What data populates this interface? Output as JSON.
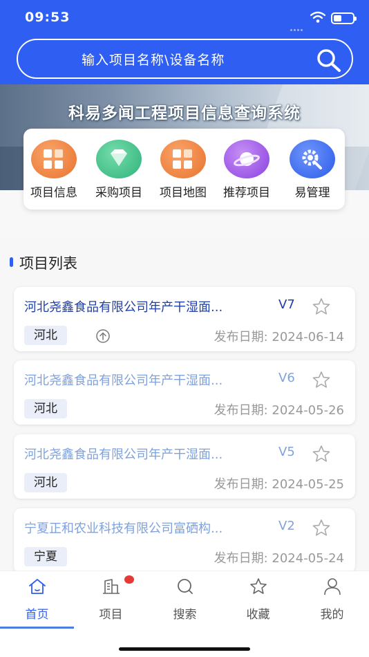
{
  "status_bar": {
    "time": "09:53"
  },
  "search": {
    "placeholder": "输入项目名称\\设备名称"
  },
  "banner": {
    "title": "科易多闻工程项目信息查询系统"
  },
  "quick_menu": [
    {
      "label": "项目信息",
      "icon": "grid-icon",
      "color": "#f0803c"
    },
    {
      "label": "采购项目",
      "icon": "diamond-icon",
      "color": "#3fc18a"
    },
    {
      "label": "项目地图",
      "icon": "grid-icon",
      "color": "#f0803c"
    },
    {
      "label": "推荐项目",
      "icon": "planet-icon",
      "color": "#a35ce8"
    },
    {
      "label": "易管理",
      "icon": "gear-wrench-icon",
      "color": "#3b6ff5"
    }
  ],
  "project_list": {
    "title": "项目列表",
    "items": [
      {
        "name": "河北尧鑫食品有限公司年产干湿面...",
        "version": "V7",
        "region": "河北",
        "date": "发布日期: 2024-06-14",
        "unread": true
      },
      {
        "name": "河北尧鑫食品有限公司年产干湿面...",
        "version": "V6",
        "region": "河北",
        "date": "发布日期: 2024-05-26",
        "unread": false
      },
      {
        "name": "河北尧鑫食品有限公司年产干湿面...",
        "version": "V5",
        "region": "河北",
        "date": "发布日期: 2024-05-25",
        "unread": false
      },
      {
        "name": "宁夏正和农业科技有限公司富硒构...",
        "version": "V2",
        "region": "宁夏",
        "date": "发布日期: 2024-05-24",
        "unread": false
      }
    ]
  },
  "tabbar": [
    {
      "label": "首页",
      "icon": "home-icon",
      "active": true
    },
    {
      "label": "项目",
      "icon": "building-icon",
      "active": false
    },
    {
      "label": "搜索",
      "icon": "search-icon",
      "active": false
    },
    {
      "label": "收藏",
      "icon": "star-icon",
      "active": false
    },
    {
      "label": "我的",
      "icon": "user-icon",
      "active": false
    }
  ],
  "colors": {
    "primary": "#2f5ef2",
    "title_unread": "#1f3fa8",
    "title_read": "#7fa2dd"
  }
}
